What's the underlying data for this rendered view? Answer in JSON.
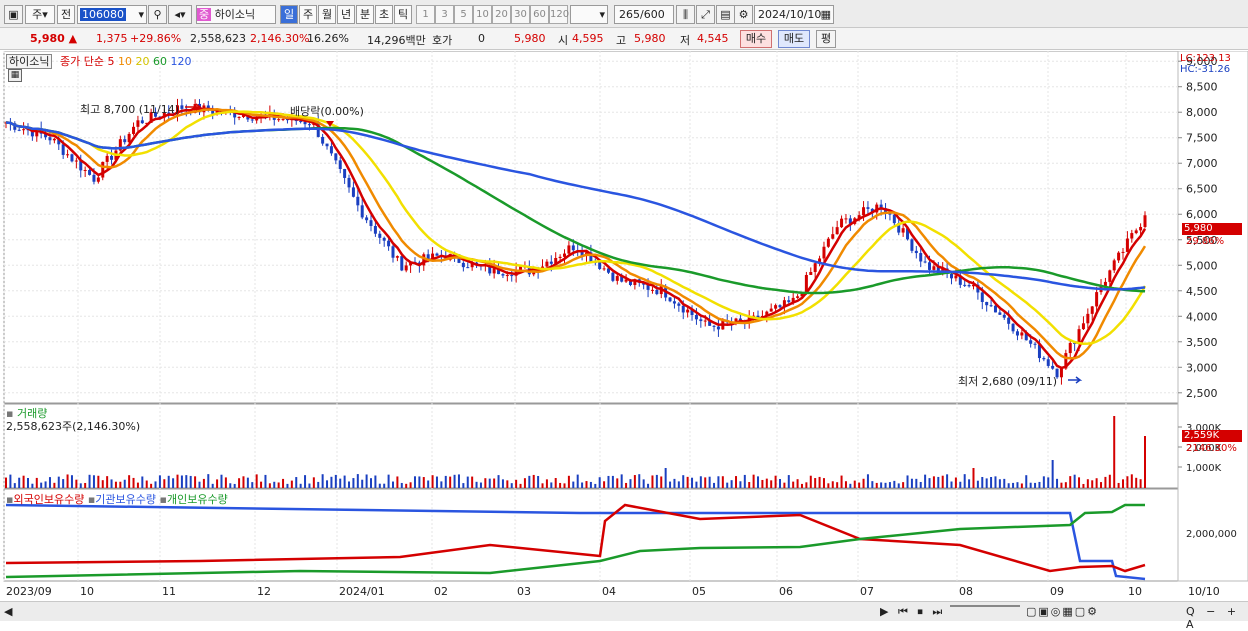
{
  "toolbar": {
    "period_day": "주",
    "prev_label": "전",
    "stock_code": "106080",
    "stock_name": "하이소닉",
    "badge": "중",
    "tabs": [
      "일",
      "주",
      "월",
      "년",
      "분",
      "초",
      "틱"
    ],
    "intervals": [
      "1",
      "3",
      "5",
      "10",
      "20",
      "30",
      "60",
      "120"
    ],
    "count": "265",
    "count_total": "/600",
    "date": "2024/10/10"
  },
  "quote": {
    "price": "5,980",
    "change": "1,375",
    "change_pct": "+29.86%",
    "volume": "2,558,623",
    "volume_pct": "2,146.30%",
    "turnover": "16.26%",
    "amount": "14,296백만",
    "hoga_label": "호가",
    "hoga_val": "0",
    "hoga_price": "5,980",
    "open_label": "시",
    "open": "4,595",
    "high_label": "고",
    "high": "5,980",
    "low_label": "저",
    "low": "4,545",
    "buy_label": "매수",
    "sell_label": "매도",
    "avg_label": "평"
  },
  "legend": {
    "name": "하이소닉",
    "indicator": "종가 단순",
    "ma": [
      "5",
      "10",
      "20",
      "60",
      "120"
    ]
  },
  "annotations": {
    "lc": "LC:123.13",
    "hc": "HC:-31.26",
    "high_note": "최고 8,700 (11/14)",
    "dividend_note": "배당락(0.00%)",
    "low_note": "최저 2,680 (09/11)",
    "last_price_tag": "5,980",
    "last_pct_tag": "29.86%"
  },
  "volume_panel": {
    "title": "거래량",
    "value": "2,558,623주(2,146.30%)",
    "last_tag": "2,559K",
    "last_pct_tag": "2146.30%"
  },
  "holdings_panel": {
    "series": [
      "외국인보유수량",
      "기관보유수량",
      "개인보유수량"
    ],
    "y_tick": "2,000,000"
  },
  "x_axis": [
    "2023/09",
    "10",
    "11",
    "12",
    "2024/01",
    "02",
    "03",
    "04",
    "05",
    "06",
    "07",
    "08",
    "09",
    "10"
  ],
  "x_axis_right": "10/10",
  "chart_data": {
    "type": "line",
    "price_axis": [
      "9,000",
      "8,500",
      "8,000",
      "7,500",
      "7,000",
      "6,500",
      "6,000",
      "5,500",
      "5,000",
      "4,500",
      "4,000",
      "3,500",
      "3,000",
      "2,500"
    ],
    "volume_axis": [
      "3,000K",
      "2,000K",
      "1,000K"
    ],
    "ylim": [
      2300,
      9200
    ],
    "months": [
      "2023/09",
      "10",
      "11",
      "12",
      "2024/01",
      "02",
      "03",
      "04",
      "05",
      "06",
      "07",
      "08",
      "09",
      "10"
    ],
    "close": [
      [
        "2023/09",
        7800
      ],
      [
        "10",
        7500
      ],
      [
        "10b",
        6700
      ],
      [
        "11",
        7800
      ],
      [
        "11b",
        8100
      ],
      [
        "12",
        8000
      ],
      [
        "12b",
        7900
      ],
      [
        "2024/01",
        7800
      ],
      [
        "01b",
        6200
      ],
      [
        "02",
        5000
      ],
      [
        "02b",
        5200
      ],
      [
        "03",
        4900
      ],
      [
        "03b",
        4900
      ],
      [
        "04",
        5400
      ],
      [
        "04b",
        4700
      ],
      [
        "05",
        4500
      ],
      [
        "05b",
        3800
      ],
      [
        "06",
        3900
      ],
      [
        "06b",
        4300
      ],
      [
        "07",
        5800
      ],
      [
        "07b",
        6200
      ],
      [
        "08",
        5000
      ],
      [
        "08b",
        4600
      ],
      [
        "09",
        3800
      ],
      [
        "09b",
        2900
      ],
      [
        "10",
        4600
      ],
      [
        "10b",
        5980
      ]
    ],
    "series": [
      {
        "name": "5",
        "color": "#d40000"
      },
      {
        "name": "10",
        "color": "#f08a00"
      },
      {
        "name": "20",
        "color": "#f2e000"
      },
      {
        "name": "60",
        "color": "#1a9a2a"
      },
      {
        "name": "120",
        "color": "#2a55e0"
      }
    ]
  },
  "colors": {
    "up": "#d40000",
    "down": "#1a3fc0",
    "ma5": "#d40000",
    "ma10": "#f08a00",
    "ma20": "#f2e000",
    "ma60": "#1a9a2a",
    "ma120": "#2a55e0"
  }
}
